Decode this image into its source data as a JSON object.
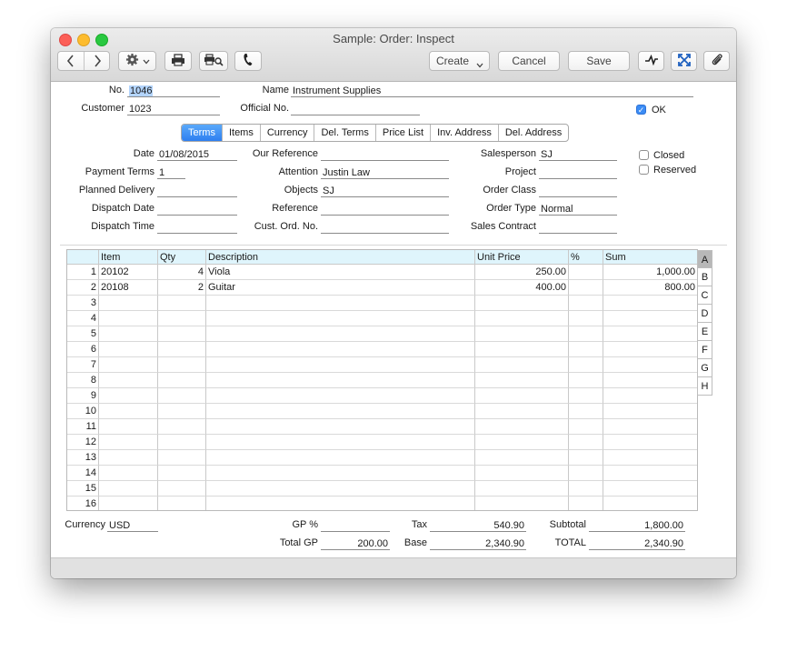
{
  "window": {
    "title": "Sample: Order: Inspect"
  },
  "toolbar": {
    "create_label": "Create",
    "cancel_label": "Cancel",
    "save_label": "Save"
  },
  "header": {
    "no_label": "No.",
    "no_value": "1046",
    "name_label": "Name",
    "name_value": "Instrument Supplies",
    "customer_label": "Customer",
    "customer_value": "1023",
    "official_label": "Official No.",
    "official_value": "",
    "ok_label": "OK",
    "ok_checked": true
  },
  "tabs": [
    "Terms",
    "Items",
    "Currency",
    "Del. Terms",
    "Price List",
    "Inv. Address",
    "Del. Address"
  ],
  "terms": {
    "date_label": "Date",
    "date_value": "01/08/2015",
    "payment_terms_label": "Payment Terms",
    "payment_terms_value": "1",
    "planned_delivery_label": "Planned Delivery",
    "planned_delivery_value": "",
    "dispatch_date_label": "Dispatch Date",
    "dispatch_date_value": "",
    "dispatch_time_label": "Dispatch Time",
    "dispatch_time_value": "",
    "our_reference_label": "Our Reference",
    "our_reference_value": "",
    "attention_label": "Attention",
    "attention_value": "Justin Law",
    "objects_label": "Objects",
    "objects_value": "SJ",
    "reference_label": "Reference",
    "reference_value": "",
    "cust_ord_label": "Cust. Ord. No.",
    "cust_ord_value": "",
    "salesperson_label": "Salesperson",
    "salesperson_value": "SJ",
    "project_label": "Project",
    "project_value": "",
    "order_class_label": "Order Class",
    "order_class_value": "",
    "order_type_label": "Order Type",
    "order_type_value": "Normal",
    "sales_contract_label": "Sales Contract",
    "sales_contract_value": "",
    "closed_label": "Closed",
    "reserved_label": "Reserved"
  },
  "grid": {
    "columns": [
      "Item",
      "Qty",
      "Description",
      "Unit Price",
      "%",
      "Sum"
    ],
    "rows": [
      {
        "n": "1",
        "item": "20102",
        "qty": "4",
        "desc": "Viola",
        "price": "250.00",
        "pct": "",
        "sum": "1,000.00"
      },
      {
        "n": "2",
        "item": "20108",
        "qty": "2",
        "desc": "Guitar",
        "price": "400.00",
        "pct": "",
        "sum": "800.00"
      },
      {
        "n": "3",
        "item": "",
        "qty": "",
        "desc": "",
        "price": "",
        "pct": "",
        "sum": ""
      },
      {
        "n": "4",
        "item": "",
        "qty": "",
        "desc": "",
        "price": "",
        "pct": "",
        "sum": ""
      },
      {
        "n": "5",
        "item": "",
        "qty": "",
        "desc": "",
        "price": "",
        "pct": "",
        "sum": ""
      },
      {
        "n": "6",
        "item": "",
        "qty": "",
        "desc": "",
        "price": "",
        "pct": "",
        "sum": ""
      },
      {
        "n": "7",
        "item": "",
        "qty": "",
        "desc": "",
        "price": "",
        "pct": "",
        "sum": ""
      },
      {
        "n": "8",
        "item": "",
        "qty": "",
        "desc": "",
        "price": "",
        "pct": "",
        "sum": ""
      },
      {
        "n": "9",
        "item": "",
        "qty": "",
        "desc": "",
        "price": "",
        "pct": "",
        "sum": ""
      },
      {
        "n": "10",
        "item": "",
        "qty": "",
        "desc": "",
        "price": "",
        "pct": "",
        "sum": ""
      },
      {
        "n": "11",
        "item": "",
        "qty": "",
        "desc": "",
        "price": "",
        "pct": "",
        "sum": ""
      },
      {
        "n": "12",
        "item": "",
        "qty": "",
        "desc": "",
        "price": "",
        "pct": "",
        "sum": ""
      },
      {
        "n": "13",
        "item": "",
        "qty": "",
        "desc": "",
        "price": "",
        "pct": "",
        "sum": ""
      },
      {
        "n": "14",
        "item": "",
        "qty": "",
        "desc": "",
        "price": "",
        "pct": "",
        "sum": ""
      },
      {
        "n": "15",
        "item": "",
        "qty": "",
        "desc": "",
        "price": "",
        "pct": "",
        "sum": ""
      },
      {
        "n": "16",
        "item": "",
        "qty": "",
        "desc": "",
        "price": "",
        "pct": "",
        "sum": ""
      }
    ],
    "side_tabs": [
      "A",
      "B",
      "C",
      "D",
      "E",
      "F",
      "G",
      "H"
    ]
  },
  "footer": {
    "currency_label": "Currency",
    "currency_value": "USD",
    "gp_label": "GP %",
    "gp_value": "",
    "total_gp_label": "Total GP",
    "total_gp_value": "200.00",
    "tax_label": "Tax",
    "tax_value": "540.90",
    "base_label": "Base",
    "base_value": "2,340.90",
    "subtotal_label": "Subtotal",
    "subtotal_value": "1,800.00",
    "total_label": "TOTAL",
    "total_value": "2,340.90"
  },
  "colors": {
    "accent": "#2e7ff0",
    "grid_header": "#dff5fc"
  }
}
